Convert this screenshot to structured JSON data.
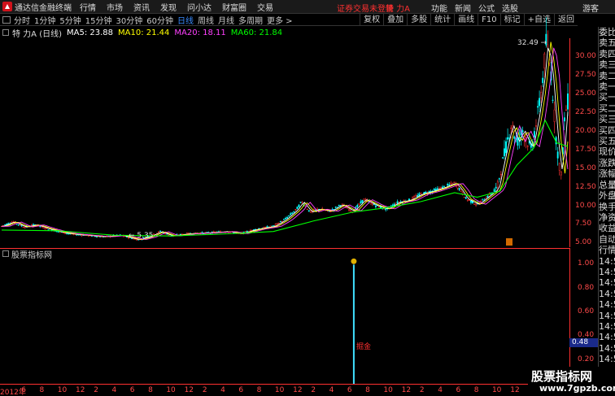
{
  "titlebar": {
    "app_title": "通达信金融终端",
    "menu": [
      "行情",
      "市场",
      "资讯",
      "发现",
      "问小达",
      "财富圈",
      "交易"
    ],
    "status_text": "证券交易未登录",
    "stock_name": "特 力A",
    "right_menu": [
      "功能",
      "新闻",
      "公式",
      "选股"
    ],
    "guest": "游客"
  },
  "toolbar": {
    "periods": [
      "分时",
      "1分钟",
      "5分钟",
      "15分钟",
      "30分钟",
      "60分钟",
      "日线",
      "周线",
      "月线",
      "多周期",
      "更多 >"
    ],
    "active_period": "日线",
    "tools": [
      "复权",
      "叠加",
      "多股",
      "统计",
      "画线",
      "F10",
      "标记",
      "+自选",
      "返回"
    ]
  },
  "info": {
    "stock": "特 力A (日线)",
    "ma5": "MA5: 23.88",
    "ma10": "MA10: 21.44",
    "ma20": "MA20: 18.11",
    "ma60": "MA60: 21.84"
  },
  "colors": {
    "ma5": "#ffffff",
    "ma10": "#ffff00",
    "ma20": "#ff40ff",
    "ma60": "#00ff00",
    "up": "#ff3030",
    "down": "#00ffff",
    "axis": "#ff3030",
    "active": "#3a8cff"
  },
  "right_panel": [
    "委比",
    "卖五",
    "卖四",
    "卖三",
    "卖二",
    "卖一",
    "买一",
    "买二",
    "买三",
    "买四",
    "买五",
    "现价",
    "涨跌",
    "涨幅",
    "总量",
    "外盘",
    "换手",
    "净资",
    "收益",
    "自动",
    "行情",
    "14:5",
    "14:5",
    "14:5",
    "14:5",
    "14:5",
    "14:5",
    "14:5",
    "14:5",
    "14:5",
    "14:5",
    "14:5"
  ],
  "main_axis": {
    "ticks": [
      "30.00",
      "27.50",
      "25.00",
      "22.50",
      "20.00",
      "17.50",
      "15.00",
      "12.50",
      "10.00",
      "7.50",
      "5.00"
    ]
  },
  "sub_axis": {
    "ticks": [
      "1.00",
      "0.80",
      "0.60",
      "0.40",
      "0.20"
    ],
    "marker": "0.48"
  },
  "indicator": {
    "name": "股票指标网",
    "signal_label": "掘金"
  },
  "annotations": {
    "low": "← 5.35",
    "high": "32.49 →"
  },
  "bottom_axis": {
    "labels": [
      "2012年",
      "6",
      "8",
      "10",
      "12",
      "2",
      "4",
      "6",
      "8",
      "10",
      "12",
      "2",
      "4",
      "6",
      "8",
      "10",
      "12",
      "2",
      "4",
      "6",
      "8",
      "10",
      "12",
      "2",
      "4",
      "6",
      "8",
      "10",
      "12",
      "2",
      "4"
    ]
  },
  "watermark": {
    "cn": "股票指标网",
    "url": "www.7gpzb.com"
  },
  "chart_data": {
    "type": "line",
    "ylim": [
      4.5,
      32.5
    ],
    "price_path": [
      [
        0.0,
        7.3
      ],
      [
        0.02,
        7.9
      ],
      [
        0.04,
        7.2
      ],
      [
        0.06,
        7.5
      ],
      [
        0.08,
        7.0
      ],
      [
        0.1,
        6.6
      ],
      [
        0.12,
        6.3
      ],
      [
        0.15,
        6.1
      ],
      [
        0.18,
        5.9
      ],
      [
        0.21,
        6.1
      ],
      [
        0.24,
        5.5
      ],
      [
        0.26,
        5.9
      ],
      [
        0.28,
        6.6
      ],
      [
        0.3,
        6.0
      ],
      [
        0.33,
        6.3
      ],
      [
        0.36,
        6.4
      ],
      [
        0.38,
        6.5
      ],
      [
        0.4,
        6.6
      ],
      [
        0.42,
        6.3
      ],
      [
        0.45,
        6.9
      ],
      [
        0.48,
        7.3
      ],
      [
        0.5,
        8.2
      ],
      [
        0.52,
        9.5
      ],
      [
        0.53,
        10.6
      ],
      [
        0.545,
        9.2
      ],
      [
        0.56,
        9.6
      ],
      [
        0.58,
        9.3
      ],
      [
        0.6,
        10.2
      ],
      [
        0.62,
        9.3
      ],
      [
        0.64,
        10.9
      ],
      [
        0.66,
        10.1
      ],
      [
        0.68,
        9.6
      ],
      [
        0.7,
        10.5
      ],
      [
        0.72,
        10.8
      ],
      [
        0.74,
        11.6
      ],
      [
        0.76,
        12.0
      ],
      [
        0.78,
        12.5
      ],
      [
        0.8,
        13.1
      ],
      [
        0.81,
        12.2
      ],
      [
        0.82,
        11.0
      ],
      [
        0.84,
        10.2
      ],
      [
        0.86,
        11.4
      ],
      [
        0.875,
        12.3
      ],
      [
        0.885,
        16.0
      ],
      [
        0.9,
        21.0
      ],
      [
        0.91,
        18.5
      ],
      [
        0.92,
        20.2
      ],
      [
        0.935,
        17.6
      ],
      [
        0.945,
        21.4
      ],
      [
        0.955,
        26.5
      ],
      [
        0.962,
        32.0
      ],
      [
        0.97,
        28.4
      ],
      [
        0.98,
        18.5
      ],
      [
        0.988,
        13.8
      ],
      [
        0.995,
        22.3
      ],
      [
        1.0,
        24.0
      ]
    ],
    "ma60_path": [
      [
        0.0,
        6.8
      ],
      [
        0.1,
        6.7
      ],
      [
        0.2,
        6.1
      ],
      [
        0.3,
        6.0
      ],
      [
        0.4,
        6.3
      ],
      [
        0.48,
        6.6
      ],
      [
        0.55,
        8.0
      ],
      [
        0.62,
        9.2
      ],
      [
        0.68,
        9.8
      ],
      [
        0.74,
        10.6
      ],
      [
        0.8,
        11.8
      ],
      [
        0.84,
        11.2
      ],
      [
        0.88,
        12.0
      ],
      [
        0.91,
        15.5
      ],
      [
        0.94,
        17.8
      ],
      [
        0.96,
        21.5
      ],
      [
        0.98,
        18.5
      ],
      [
        1.0,
        18.0
      ]
    ],
    "indicator_signal": {
      "x": 0.622,
      "value": 1.0
    },
    "sub_ylim": [
      0,
      1.05
    ]
  }
}
